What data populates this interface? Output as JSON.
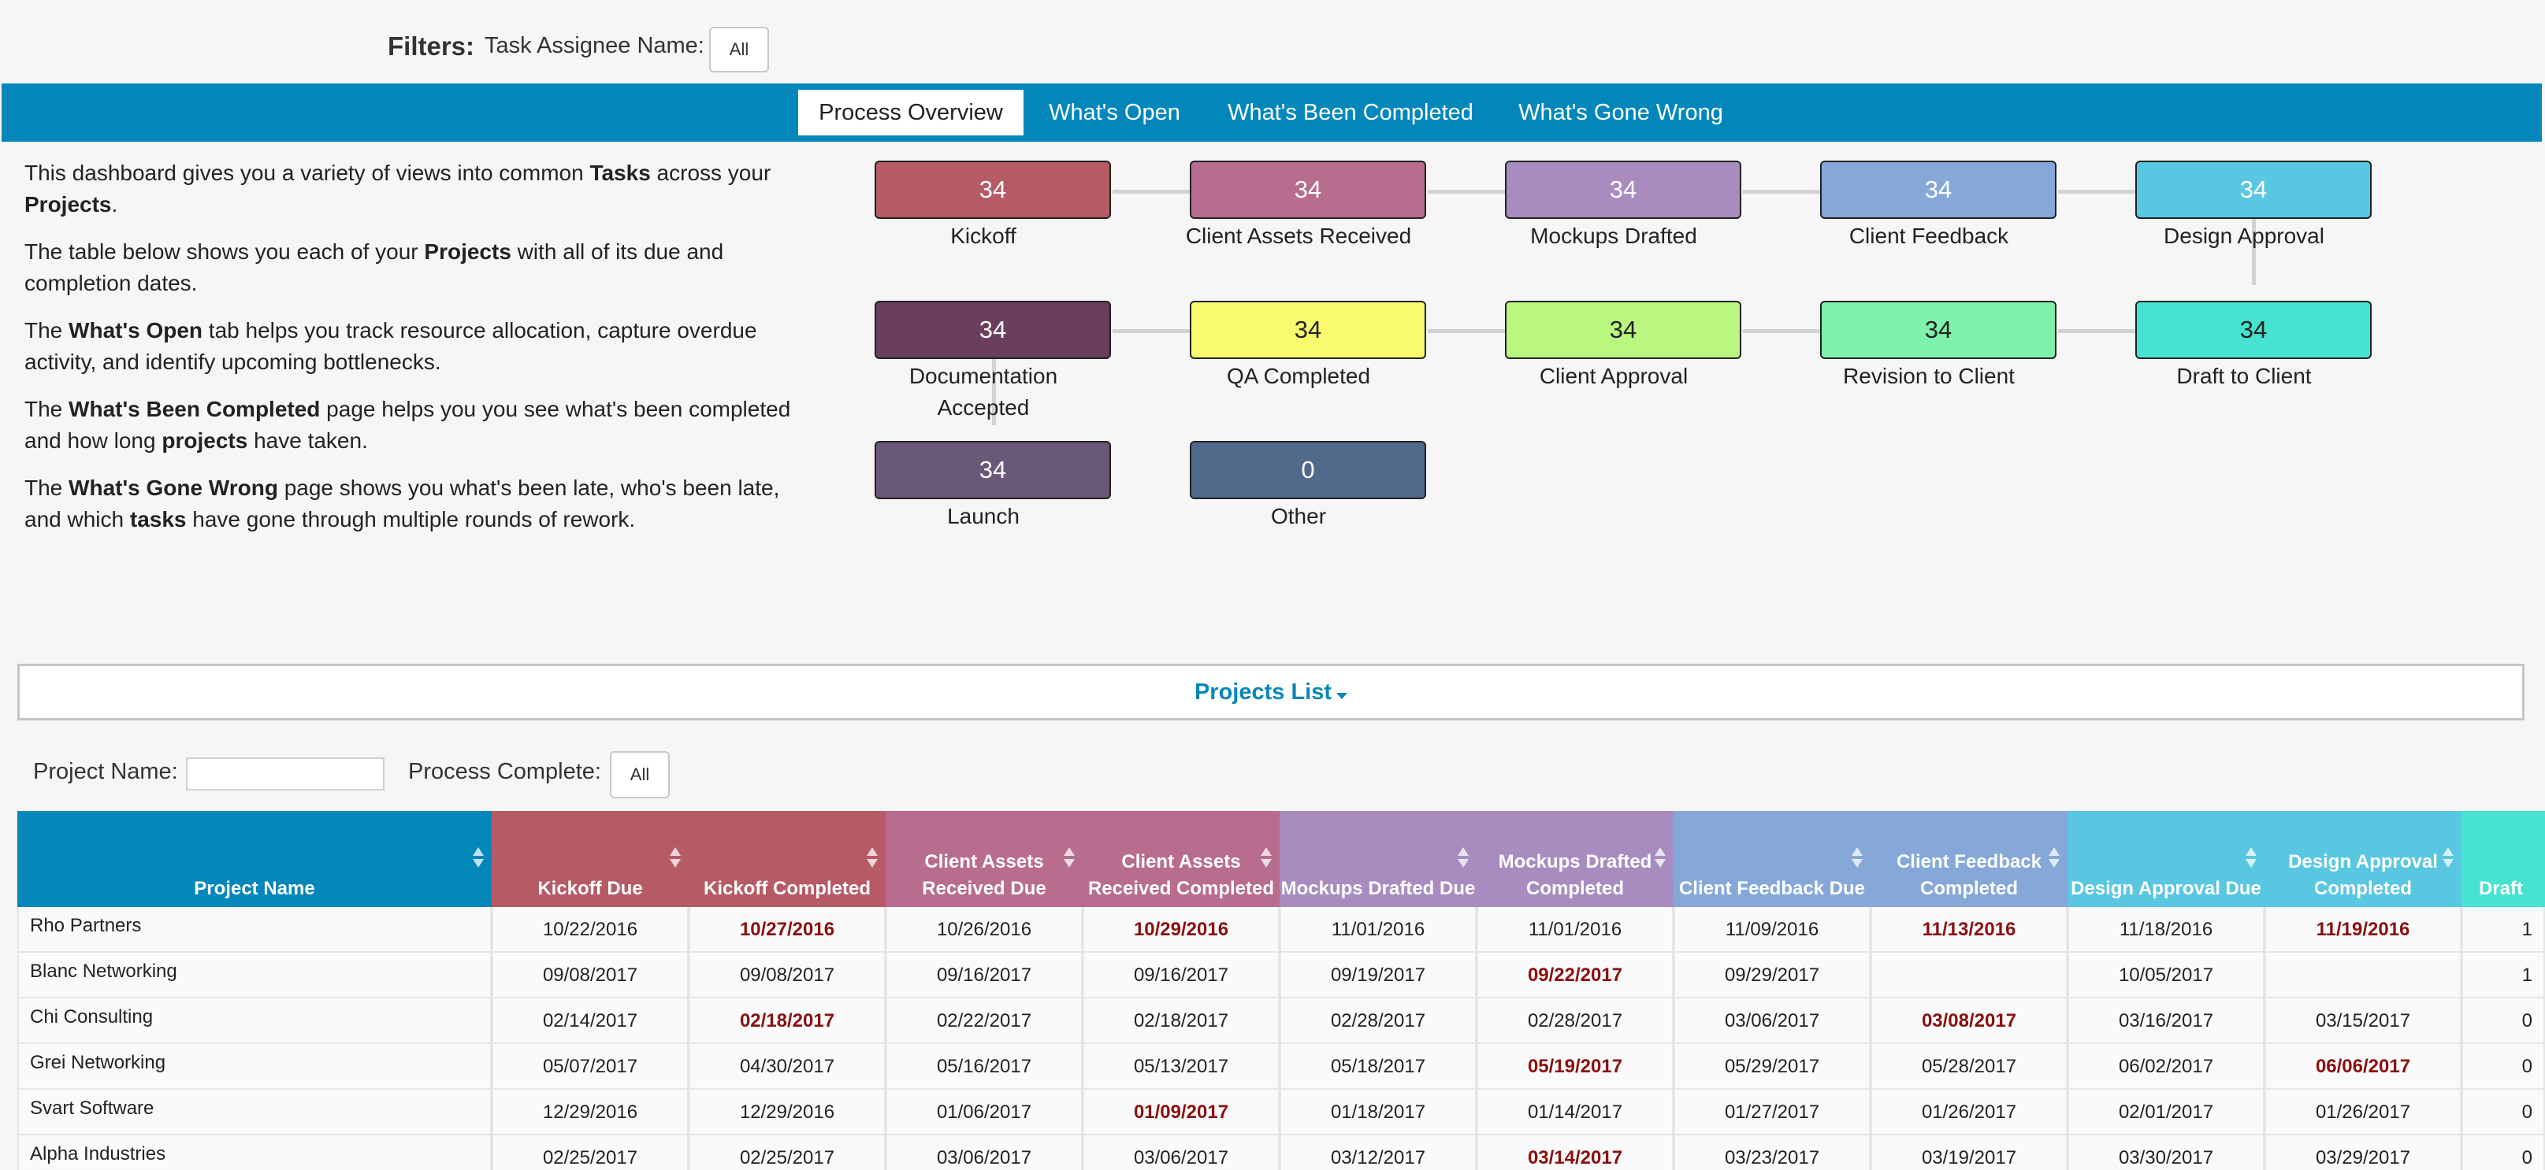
{
  "filters": {
    "title": "Filters:",
    "assignee_label": "Task Assignee Name:",
    "assignee_value": "All"
  },
  "tabs": [
    {
      "label": "Process Overview",
      "active": true
    },
    {
      "label": "What's Open",
      "active": false
    },
    {
      "label": "What's Been Completed",
      "active": false
    },
    {
      "label": "What's Gone Wrong",
      "active": false
    }
  ],
  "description": {
    "p1": {
      "a": "This dashboard gives you a variety of views into common ",
      "b1": "Tasks",
      "c": " across your ",
      "b2": "Projects",
      "d": "."
    },
    "p2": {
      "a": "The table below shows you each of your ",
      "b1": "Projects",
      "c": " with all of its due and completion dates."
    },
    "p3": {
      "a": "The ",
      "b1": "What's Open",
      "c": " tab helps you track resource allocation, capture overdue activity, and identify upcoming bottlenecks."
    },
    "p4": {
      "a": "The ",
      "b1": "What's Been Completed",
      "c": " page helps you you see what's been completed and how long ",
      "b2": "projects",
      "d": " have taken."
    },
    "p5": {
      "a": "The ",
      "b1": "What's Gone Wrong",
      "c": " page shows you what's been late, who's been late, and which ",
      "b2": "tasks",
      "d": " have gone through multiple rounds of rework."
    }
  },
  "flow": {
    "nodes": [
      {
        "count": "34",
        "label": "Kickoff",
        "color": "#b65b66"
      },
      {
        "count": "34",
        "label": "Client Assets Received",
        "color": "#b86c8e"
      },
      {
        "count": "34",
        "label": "Mockups Drafted",
        "color": "#a88cc0"
      },
      {
        "count": "34",
        "label": "Client Feedback",
        "color": "#85a8d8"
      },
      {
        "count": "34",
        "label": "Design Approval",
        "color": "#5ac7e2"
      },
      {
        "count": "34",
        "label": "Documentation Accepted",
        "color": "#6a3f5e"
      },
      {
        "count": "34",
        "label": "QA Completed",
        "color": "#fafa6e"
      },
      {
        "count": "34",
        "label": "Client Approval",
        "color": "#baf781"
      },
      {
        "count": "34",
        "label": "Revision to Client",
        "color": "#7ef1ad"
      },
      {
        "count": "34",
        "label": "Draft to Client",
        "color": "#45e3d0"
      },
      {
        "count": "34",
        "label": "Launch",
        "color": "#695877"
      },
      {
        "count": "0",
        "label": "Other",
        "color": "#51698b"
      }
    ]
  },
  "projects": {
    "header": "Projects List",
    "name_label": "Project Name:",
    "name_value": "",
    "complete_label": "Process Complete:",
    "complete_value": "All"
  },
  "table": {
    "columns": [
      {
        "label": "Project Name",
        "color": "#0387bb"
      },
      {
        "label": "Kickoff Due",
        "color": "#b65b66"
      },
      {
        "label": "Kickoff Completed",
        "color": "#b65b66"
      },
      {
        "label": "Client Assets Received Due",
        "color": "#b86c8e"
      },
      {
        "label": "Client Assets Received Completed",
        "color": "#b86c8e"
      },
      {
        "label": "Mockups Drafted Due",
        "color": "#a88cc0"
      },
      {
        "label": "Mockups Drafted Completed",
        "color": "#a88cc0"
      },
      {
        "label": "Client Feedback Due",
        "color": "#85a8d8"
      },
      {
        "label": "Client Feedback Completed",
        "color": "#85a8d8"
      },
      {
        "label": "Design Approval Due",
        "color": "#5ac7e2"
      },
      {
        "label": "Design Approval Completed",
        "color": "#5ac7e2"
      },
      {
        "label": "Draft",
        "color": "#45e3d0"
      }
    ],
    "rows": [
      {
        "name": "Rho Partners",
        "cells": [
          {
            "v": "10/22/2016"
          },
          {
            "v": "10/27/2016",
            "late": true
          },
          {
            "v": "10/26/2016"
          },
          {
            "v": "10/29/2016",
            "late": true
          },
          {
            "v": "11/01/2016"
          },
          {
            "v": "11/01/2016"
          },
          {
            "v": "11/09/2016"
          },
          {
            "v": "11/13/2016",
            "late": true
          },
          {
            "v": "11/18/2016"
          },
          {
            "v": "11/19/2016",
            "late": true
          },
          {
            "v": "1"
          }
        ]
      },
      {
        "name": "Blanc Networking",
        "cells": [
          {
            "v": "09/08/2017"
          },
          {
            "v": "09/08/2017"
          },
          {
            "v": "09/16/2017"
          },
          {
            "v": "09/16/2017"
          },
          {
            "v": "09/19/2017"
          },
          {
            "v": "09/22/2017",
            "late": true
          },
          {
            "v": "09/29/2017"
          },
          {
            "v": ""
          },
          {
            "v": "10/05/2017"
          },
          {
            "v": ""
          },
          {
            "v": "1"
          }
        ]
      },
      {
        "name": "Chi Consulting",
        "cells": [
          {
            "v": "02/14/2017"
          },
          {
            "v": "02/18/2017",
            "late": true
          },
          {
            "v": "02/22/2017"
          },
          {
            "v": "02/18/2017"
          },
          {
            "v": "02/28/2017"
          },
          {
            "v": "02/28/2017"
          },
          {
            "v": "03/06/2017"
          },
          {
            "v": "03/08/2017",
            "late": true
          },
          {
            "v": "03/16/2017"
          },
          {
            "v": "03/15/2017"
          },
          {
            "v": "0"
          }
        ]
      },
      {
        "name": "Grei Networking",
        "cells": [
          {
            "v": "05/07/2017"
          },
          {
            "v": "04/30/2017"
          },
          {
            "v": "05/16/2017"
          },
          {
            "v": "05/13/2017"
          },
          {
            "v": "05/18/2017"
          },
          {
            "v": "05/19/2017",
            "late": true
          },
          {
            "v": "05/29/2017"
          },
          {
            "v": "05/28/2017"
          },
          {
            "v": "06/02/2017"
          },
          {
            "v": "06/06/2017",
            "late": true
          },
          {
            "v": "0"
          }
        ]
      },
      {
        "name": "Svart Software",
        "cells": [
          {
            "v": "12/29/2016"
          },
          {
            "v": "12/29/2016"
          },
          {
            "v": "01/06/2017"
          },
          {
            "v": "01/09/2017",
            "late": true
          },
          {
            "v": "01/18/2017"
          },
          {
            "v": "01/14/2017"
          },
          {
            "v": "01/27/2017"
          },
          {
            "v": "01/26/2017"
          },
          {
            "v": "02/01/2017"
          },
          {
            "v": "01/26/2017"
          },
          {
            "v": "0"
          }
        ]
      },
      {
        "name": "Alpha Industries",
        "cells": [
          {
            "v": "02/25/2017"
          },
          {
            "v": "02/25/2017"
          },
          {
            "v": "03/06/2017"
          },
          {
            "v": "03/06/2017"
          },
          {
            "v": "03/12/2017"
          },
          {
            "v": "03/14/2017",
            "late": true
          },
          {
            "v": "03/23/2017"
          },
          {
            "v": "03/19/2017"
          },
          {
            "v": "03/30/2017"
          },
          {
            "v": "03/29/2017"
          },
          {
            "v": "0"
          }
        ]
      }
    ]
  }
}
